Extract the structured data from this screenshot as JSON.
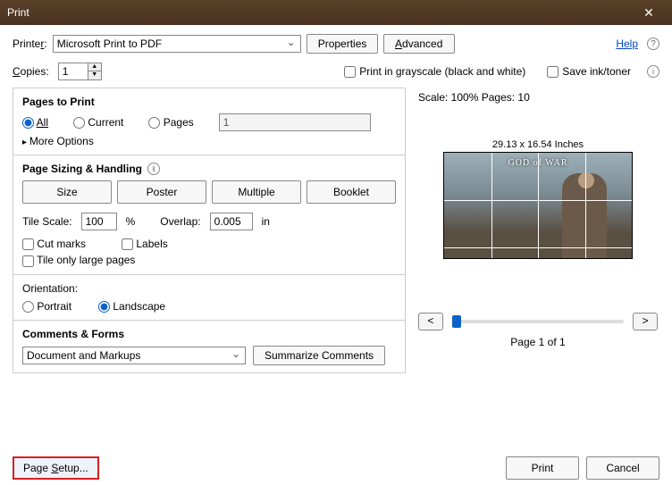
{
  "window": {
    "title": "Print"
  },
  "printer": {
    "label_html": "Printer:",
    "selected": "Microsoft Print to PDF",
    "properties_btn": "Properties",
    "advanced_btn": "Advanced"
  },
  "help": {
    "label": "Help"
  },
  "copies": {
    "label_html": "Copies:",
    "value": "1"
  },
  "options": {
    "grayscale": "Print in grayscale (black and white)",
    "saveink": "Save ink/toner"
  },
  "pages_to_print": {
    "title": "Pages to Print",
    "all": "All",
    "current": "Current",
    "pages": "Pages",
    "pages_value": "1",
    "more": "More Options"
  },
  "sizing": {
    "title": "Page Sizing & Handling",
    "size": "Size",
    "poster": "Poster",
    "multiple": "Multiple",
    "booklet": "Booklet",
    "tile_scale_label": "Tile Scale:",
    "tile_scale_value": "100",
    "percent": "%",
    "overlap_label": "Overlap:",
    "overlap_value": "0.005",
    "overlap_unit": "in",
    "cut_marks": "Cut marks",
    "labels": "Labels",
    "tile_large": "Tile only large pages"
  },
  "orientation": {
    "title": "Orientation:",
    "portrait": "Portrait",
    "landscape": "Landscape"
  },
  "comments": {
    "title": "Comments & Forms",
    "selected": "Document and Markups",
    "summarize": "Summarize Comments"
  },
  "preview": {
    "scale_pages": "Scale: 100% Pages: 10",
    "dimensions": "29.13 x 16.54 Inches",
    "logo": "GOD of WAR",
    "page_of": "Page 1 of 1",
    "prev": "<",
    "next": ">"
  },
  "footer": {
    "page_setup": "Page Setup...",
    "print": "Print",
    "cancel": "Cancel"
  }
}
